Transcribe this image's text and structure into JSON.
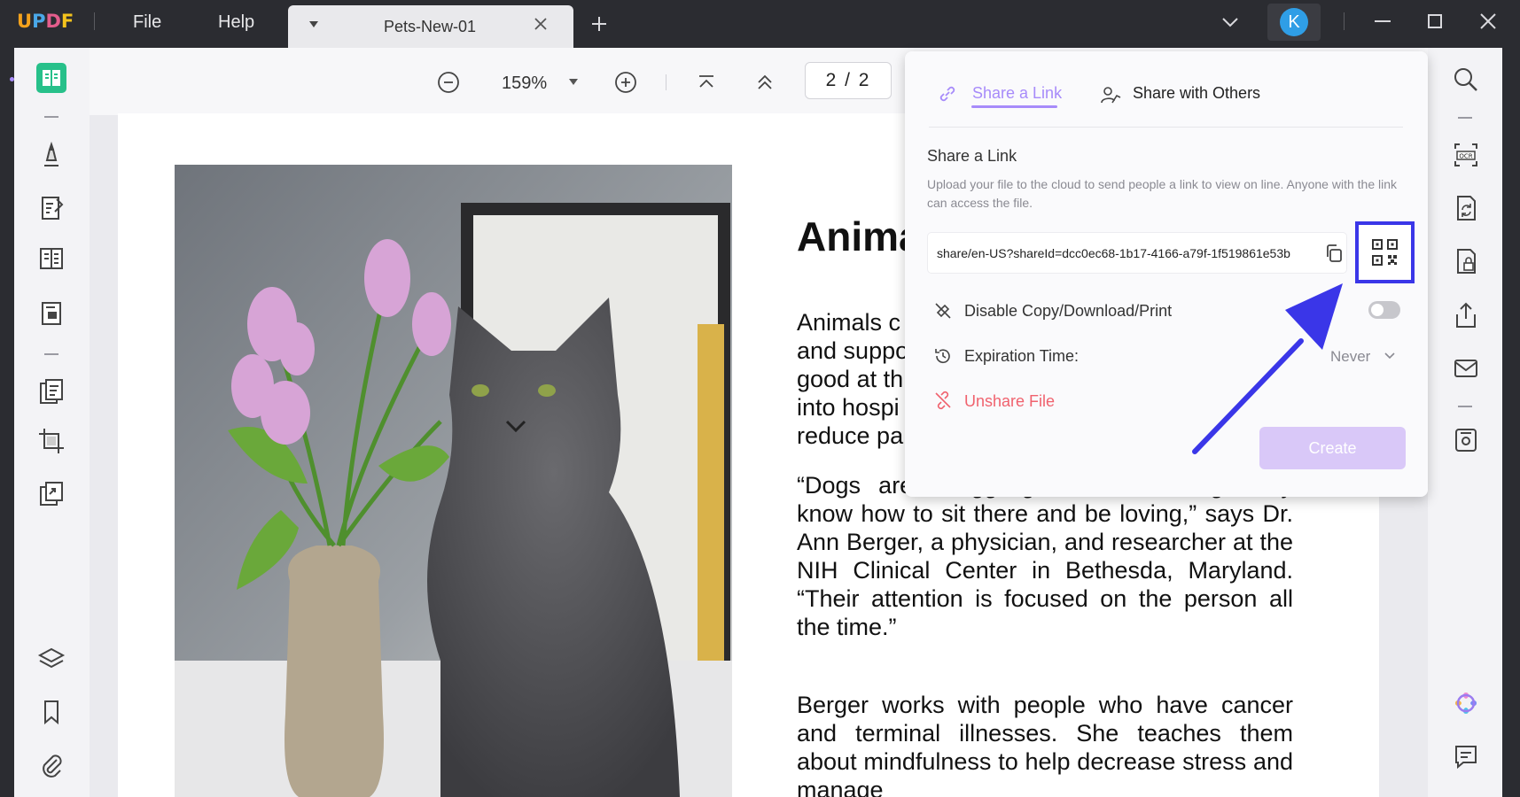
{
  "titlebar": {
    "logo": "UPDF",
    "menu": [
      "File",
      "Help"
    ],
    "tab_title": "Pets-New-01",
    "avatar_letter": "K"
  },
  "toolbar": {
    "zoom": "159%",
    "page_indicator": "2 / 2"
  },
  "document": {
    "title": "Anima",
    "paragraphs": [
      "Animals c and suppo good at th into hospi reduce pa",
      "“Dogs are struggling with something, they know how to sit there and be loving,” says Dr. Ann Berger, a physician, and researcher at the NIH Clinical Center in Bethesda, Maryland. “Their attention is focused on the person all the time.”",
      "Berger works with people who have cancer and terminal illnesses. She teaches them about mindfulness to help decrease stress and manage"
    ]
  },
  "share_panel": {
    "tabs": [
      "Share a Link",
      "Share with Others"
    ],
    "active_tab": "Share a Link",
    "heading": "Share a Link",
    "description": "Upload your file to the cloud to send people a link to view on line. Anyone with the link can access the file.",
    "link_url": "share/en-US?shareId=dcc0ec68-1b17-4166-a79f-1f519861e53b",
    "disable_label": "Disable Copy/Download/Print",
    "disable_enabled": false,
    "expiration_label": "Expiration Time:",
    "expiration_value": "Never",
    "unshare_label": "Unshare File",
    "create_label": "Create"
  },
  "colors": {
    "accent": "#a78bfa",
    "highlight": "#3a36e8",
    "danger": "#f0626e",
    "titlebar": "#2b2c31"
  },
  "icons": {
    "left_sidebar": [
      "reader-icon",
      "highlight-pen-icon",
      "edit-text-icon",
      "page-layout-icon",
      "form-icon",
      "organize-pages-icon",
      "crop-icon",
      "duplicate-icon",
      "layers-icon",
      "bookmark-icon",
      "attachment-icon"
    ],
    "right_sidebar": [
      "search-icon",
      "ocr-icon",
      "convert-icon",
      "protect-icon",
      "share-icon",
      "email-icon",
      "save-icon",
      "ai-assistant-icon",
      "comment-icon"
    ]
  }
}
